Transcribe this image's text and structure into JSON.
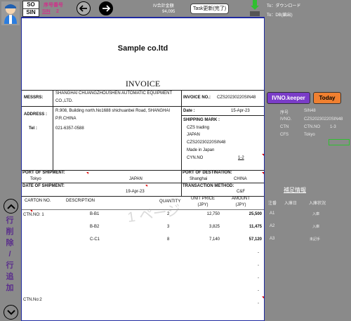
{
  "topbar": {
    "so_label": "SO",
    "sin_label": "SIN",
    "seq_label": "序号番号",
    "sin_value": "SIN",
    "seq_value": "2",
    "total_label": "IV合計金額",
    "total_value": "94,095",
    "task_button": "Task更新(完了)",
    "to_download": "To：ダウンロード",
    "to_db": "To：DB(編出)"
  },
  "doc": {
    "company": "Sample co.ltd",
    "title": "INVOICE",
    "messrs_label": "MESSRS:",
    "messrs_value_1": "SHANGHAI CHUANGZHOUSHEN AUTOMATIC EQUIPMENT",
    "messrs_value_2": "CO.,LTD.",
    "address_label": "ADDRESS :",
    "address_value_1": "R.908, Building north.No1688 shichuanbei Road, SHANGHAI",
    "address_value_2": "P.R.CHINA",
    "tel_label": "Tel :",
    "tel_value": "021-6357-0588",
    "invoice_no_label": "INVOICE NO.:",
    "invoice_no_value": "CZS20230220SIN48",
    "date_label": "Date :",
    "date_value": "15-Apr-23",
    "shipping_mark_label": "SHIPPING MARK :",
    "sm_1": "CZS trading",
    "sm_2": "JAPAN",
    "sm_3": "CZS20230220SIN48",
    "sm_4": "Made in Japan",
    "sm_5": "CYN.NO",
    "sm_6": "1-2",
    "port_ship_label": "PORT OF SHIPMENT:",
    "port_ship_city": "Tokyo",
    "port_ship_country": "JAPAN",
    "port_dest_label": "PORT OF DESTINATION:",
    "port_dest_city": "Shanghai",
    "port_dest_country": "CHINA",
    "date_ship_label": "DATE OF SHIPMENT:",
    "date_ship_value": "19-Apr-23",
    "trans_label": "TRANSACTION METHOD:",
    "trans_value": "C&F",
    "headers": {
      "carton": "CARTON NO.",
      "desc": "DESCRIPTION",
      "qty": "QUANTITY",
      "unit1": "UNIT PRICE",
      "unit2": "(JPY)",
      "amt1": "AMOUNT",
      "amt2": "(JPY)"
    },
    "carton_no_1": "CTN.NO: 1",
    "carton_no_2": "CTN.No:2",
    "rows": [
      {
        "desc": "B-B1",
        "qty": "2",
        "unit": "12,750",
        "amount": "25,500"
      },
      {
        "desc": "B-B2",
        "qty": "3",
        "unit": "3,825",
        "amount": "11,475"
      },
      {
        "desc": "C-C1",
        "qty": "8",
        "unit": "7,140",
        "amount": "57,120"
      }
    ],
    "dashes": [
      "-",
      "-",
      "-",
      "-",
      "-"
    ],
    "watermark": "1 ページ"
  },
  "right": {
    "ivno_keeper": "IVNO.keeper",
    "today": "Today",
    "info": [
      {
        "k": "序号",
        "v": "SIN48"
      },
      {
        "k": "IVNO.",
        "v": "CZS20230220SIN48"
      },
      {
        "k": "CTN",
        "v": "CTN.NO",
        "v2": "1-3"
      },
      {
        "k": "CFS",
        "v": "Tokyo"
      }
    ],
    "hokusoku": "補足情報",
    "col_note": "注番",
    "col_in": "入庫日",
    "col_status": "入庫状況",
    "rows": [
      {
        "note": "A1",
        "status": "入庫"
      },
      {
        "note": "A2",
        "status": "入庫"
      },
      {
        "note": "A3",
        "status": "未記手"
      }
    ]
  },
  "left": {
    "vertical_text": [
      "行",
      "削",
      "除",
      "/",
      "行",
      "追",
      "加"
    ]
  },
  "colors": {
    "ivno_keeper_bg": "#7a3cc8",
    "today_bg": "#f08030",
    "doc_border": "#1f2aa0",
    "vertical_text": "#5a2d8c"
  }
}
